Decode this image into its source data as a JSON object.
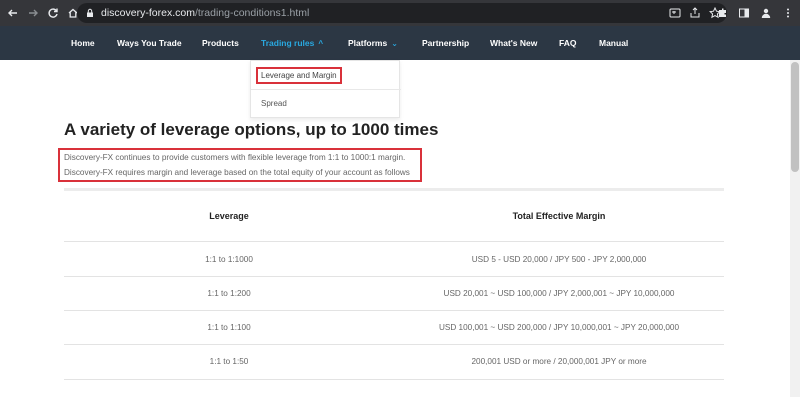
{
  "browser": {
    "url_domain": "discovery-forex.com",
    "url_path": "/trading-conditions1.html"
  },
  "nav": {
    "items": [
      {
        "label": "Home"
      },
      {
        "label": "Ways You Trade"
      },
      {
        "label": "Products"
      },
      {
        "label": "Trading rules"
      },
      {
        "label": "Platforms"
      },
      {
        "label": "Partnership"
      },
      {
        "label": "What's New"
      },
      {
        "label": "FAQ"
      },
      {
        "label": "Manual"
      }
    ],
    "active_color": "#29a8e0",
    "bg_color": "#2c3744"
  },
  "dropdown": {
    "items": [
      {
        "label": "Leverage and Margin"
      },
      {
        "label": "Spread"
      }
    ]
  },
  "main": {
    "title": "A variety of leverage options, up to 1000 times",
    "desc1": "Discovery-FX continues to provide customers with flexible leverage from 1:1 to 1000:1 margin.",
    "desc2": "Discovery-FX requires margin and leverage based on the total equity of your account as follows",
    "highlight_color": "#d9313a"
  },
  "table": {
    "headers": [
      "Leverage",
      "Total Effective Margin"
    ],
    "rows": [
      [
        "1:1 to 1:1000",
        "USD 5 - USD 20,000 / JPY 500 - JPY 2,000,000"
      ],
      [
        "1:1 to 1:200",
        "USD 20,001 ~ USD 100,000 / JPY 2,000,001 ~ JPY 10,000,000"
      ],
      [
        "1:1 to 1:100",
        "USD 100,001 ~ USD 200,000 / JPY 10,000,001 ~ JPY 20,000,000"
      ],
      [
        "1:1 to 1:50",
        "200,001 USD or more / 20,000,001 JPY or more"
      ]
    ]
  }
}
